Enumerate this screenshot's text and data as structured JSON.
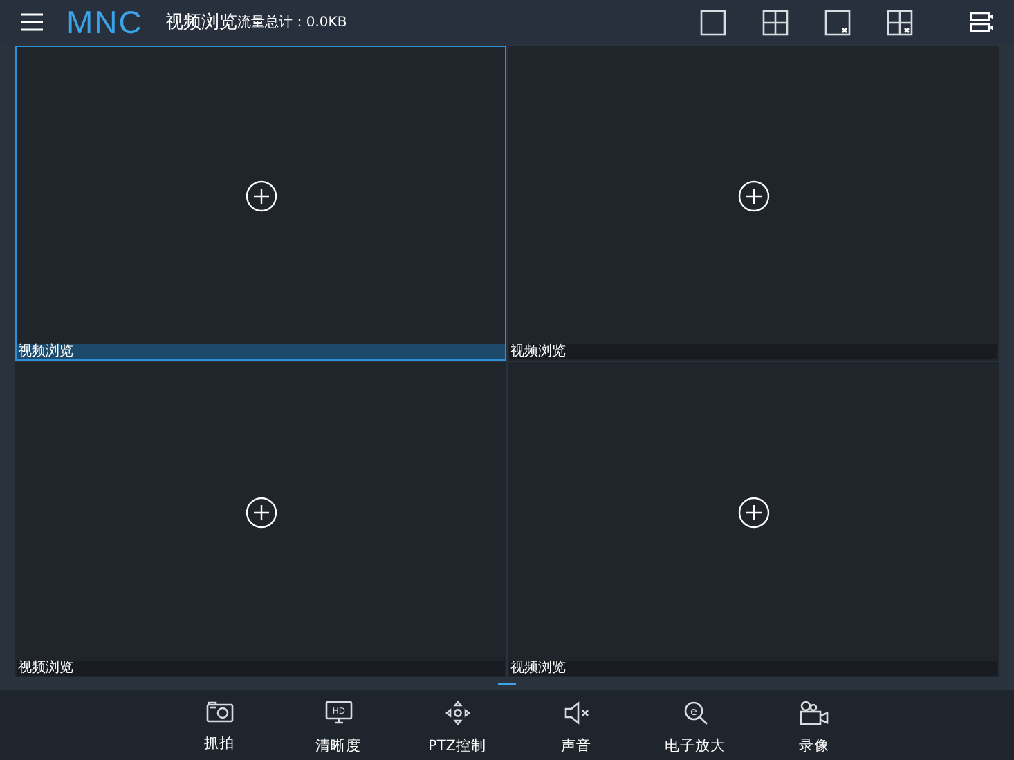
{
  "header": {
    "logo": "MNC",
    "title": "视频浏览",
    "traffic": "流量总计：0.0KB",
    "layout_buttons": [
      {
        "kind": "single"
      },
      {
        "kind": "quad"
      },
      {
        "kind": "single-close"
      },
      {
        "kind": "quad-close"
      },
      {
        "kind": "list"
      }
    ]
  },
  "panels": [
    {
      "label": "视频浏览",
      "selected": true
    },
    {
      "label": "视频浏览",
      "selected": false
    },
    {
      "label": "视频浏览",
      "selected": false
    },
    {
      "label": "视频浏览",
      "selected": false
    }
  ],
  "toolbar": [
    {
      "kind": "camera",
      "label": "抓拍"
    },
    {
      "kind": "hd",
      "label": "清晰度",
      "icon_text": "HD"
    },
    {
      "kind": "ptz",
      "label": "PTZ控制"
    },
    {
      "kind": "mute",
      "label": "声音"
    },
    {
      "kind": "zoom",
      "label": "电子放大",
      "icon_text": "e"
    },
    {
      "kind": "record",
      "label": "录像"
    }
  ]
}
